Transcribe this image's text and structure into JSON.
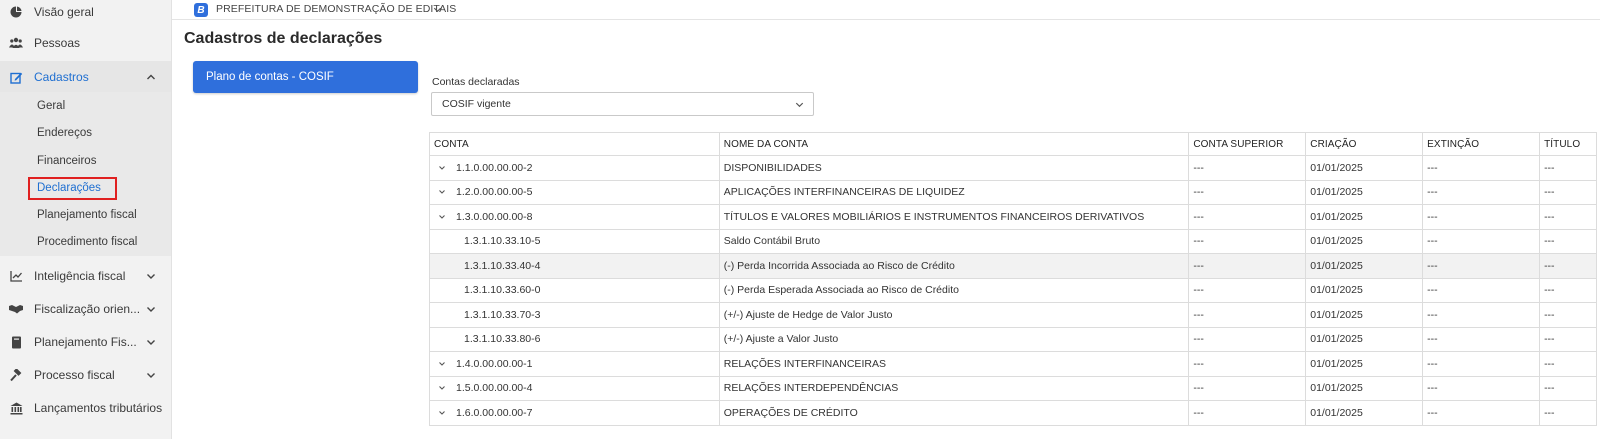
{
  "sidebar": {
    "items": [
      {
        "label": "Visão geral",
        "icon": "pie-chart-icon"
      },
      {
        "label": "Pessoas",
        "icon": "people-icon"
      },
      {
        "label": "Cadastros",
        "icon": "edit-icon"
      },
      {
        "label": "Inteligência fiscal",
        "icon": "line-chart-icon"
      },
      {
        "label": "Fiscalização orien...",
        "icon": "handshake-icon"
      },
      {
        "label": "Planejamento Fis...",
        "icon": "book-icon"
      },
      {
        "label": "Processo fiscal",
        "icon": "gavel-icon"
      },
      {
        "label": "Lançamentos tributários",
        "icon": "bank-icon"
      }
    ],
    "cadastros_sub": [
      "Geral",
      "Endereços",
      "Financeiros",
      "Declarações",
      "Planejamento fiscal",
      "Procedimento fiscal"
    ]
  },
  "header": {
    "org_badge": "B",
    "org_name": "PREFEITURA DE DEMONSTRAÇÃO DE EDITAIS"
  },
  "page": {
    "title": "Cadastros de declarações",
    "tab_label": "Plano de contas - COSIF",
    "field_label": "Contas declaradas",
    "select_value": "COSIF vigente"
  },
  "table": {
    "columns": [
      "CONTA",
      "NOME DA CONTA",
      "CONTA SUPERIOR",
      "CRIAÇÃO",
      "EXTINÇÃO",
      "TÍTULO"
    ],
    "rows": [
      {
        "conta": "1.1.0.00.00.00-2",
        "nome": "DISPONIBILIDADES",
        "superior": "---",
        "criacao": "01/01/2025",
        "extincao": "---",
        "titulo": "---"
      },
      {
        "conta": "1.2.0.00.00.00-5",
        "nome": "APLICAÇÕES INTERFINANCEIRAS DE LIQUIDEZ",
        "superior": "---",
        "criacao": "01/01/2025",
        "extincao": "---",
        "titulo": "---"
      },
      {
        "conta": "1.3.0.00.00.00-8",
        "nome": "TÍTULOS E VALORES MOBILIÁRIOS E INSTRUMENTOS FINANCEIROS DERIVATIVOS",
        "superior": "---",
        "criacao": "01/01/2025",
        "extincao": "---",
        "titulo": "---"
      },
      {
        "conta": "1.3.1.10.33.10-5",
        "nome": "Saldo Contábil Bruto",
        "superior": "---",
        "criacao": "01/01/2025",
        "extincao": "---",
        "titulo": "---"
      },
      {
        "conta": "1.3.1.10.33.40-4",
        "nome": "(-) Perda Incorrida Associada ao Risco de Crédito",
        "superior": "---",
        "criacao": "01/01/2025",
        "extincao": "---",
        "titulo": "---"
      },
      {
        "conta": "1.3.1.10.33.60-0",
        "nome": "(-) Perda Esperada Associada ao Risco de Crédito",
        "superior": "---",
        "criacao": "01/01/2025",
        "extincao": "---",
        "titulo": "---"
      },
      {
        "conta": "1.3.1.10.33.70-3",
        "nome": "(+/-) Ajuste de Hedge de Valor Justo",
        "superior": "---",
        "criacao": "01/01/2025",
        "extincao": "---",
        "titulo": "---"
      },
      {
        "conta": "1.3.1.10.33.80-6",
        "nome": "(+/-) Ajuste a Valor Justo",
        "superior": "---",
        "criacao": "01/01/2025",
        "extincao": "---",
        "titulo": "---"
      },
      {
        "conta": "1.4.0.00.00.00-1",
        "nome": "RELAÇÕES INTERFINANCEIRAS",
        "superior": "---",
        "criacao": "01/01/2025",
        "extincao": "---",
        "titulo": "---"
      },
      {
        "conta": "1.5.0.00.00.00-4",
        "nome": "RELAÇÕES INTERDEPENDÊNCIAS",
        "superior": "---",
        "criacao": "01/01/2025",
        "extincao": "---",
        "titulo": "---"
      },
      {
        "conta": "1.6.0.00.00.00-7",
        "nome": "OPERAÇÕES DE CRÉDITO",
        "superior": "---",
        "criacao": "01/01/2025",
        "extincao": "---",
        "titulo": "---"
      }
    ]
  },
  "colors": {
    "accent": "#2f6fdc",
    "active_text": "#1f6fd1",
    "selection_outline": "#e02020",
    "sidebar_bg": "#f2f2f2"
  }
}
